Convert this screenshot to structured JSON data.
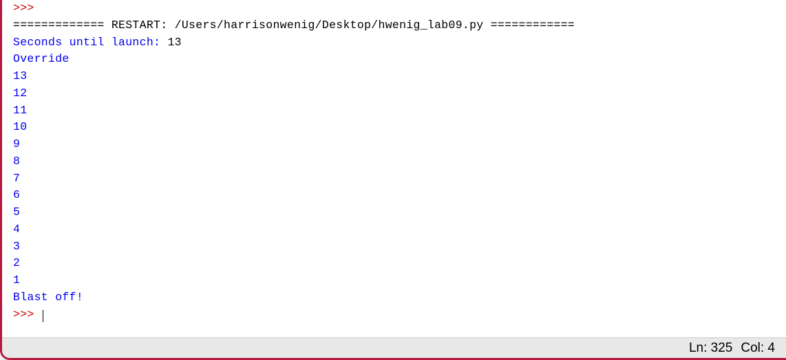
{
  "console": {
    "prompt_top": ">>> ",
    "restart_prefix": "============= RESTART: ",
    "restart_path": "/Users/harrisonwenig/Desktop/hwenig_lab09.py",
    "restart_suffix": " ============",
    "input_prompt": "Seconds until launch: ",
    "input_value": "13",
    "output_lines": [
      "Override",
      "13",
      "12",
      "11",
      "10",
      "9",
      "8",
      "7",
      "6",
      "5",
      "4",
      "3",
      "2",
      "1",
      "Blast off!"
    ],
    "prompt_bottom": ">>> "
  },
  "status": {
    "line_label": "Ln: ",
    "line_value": "325",
    "col_label": "Col: ",
    "col_value": "4"
  }
}
